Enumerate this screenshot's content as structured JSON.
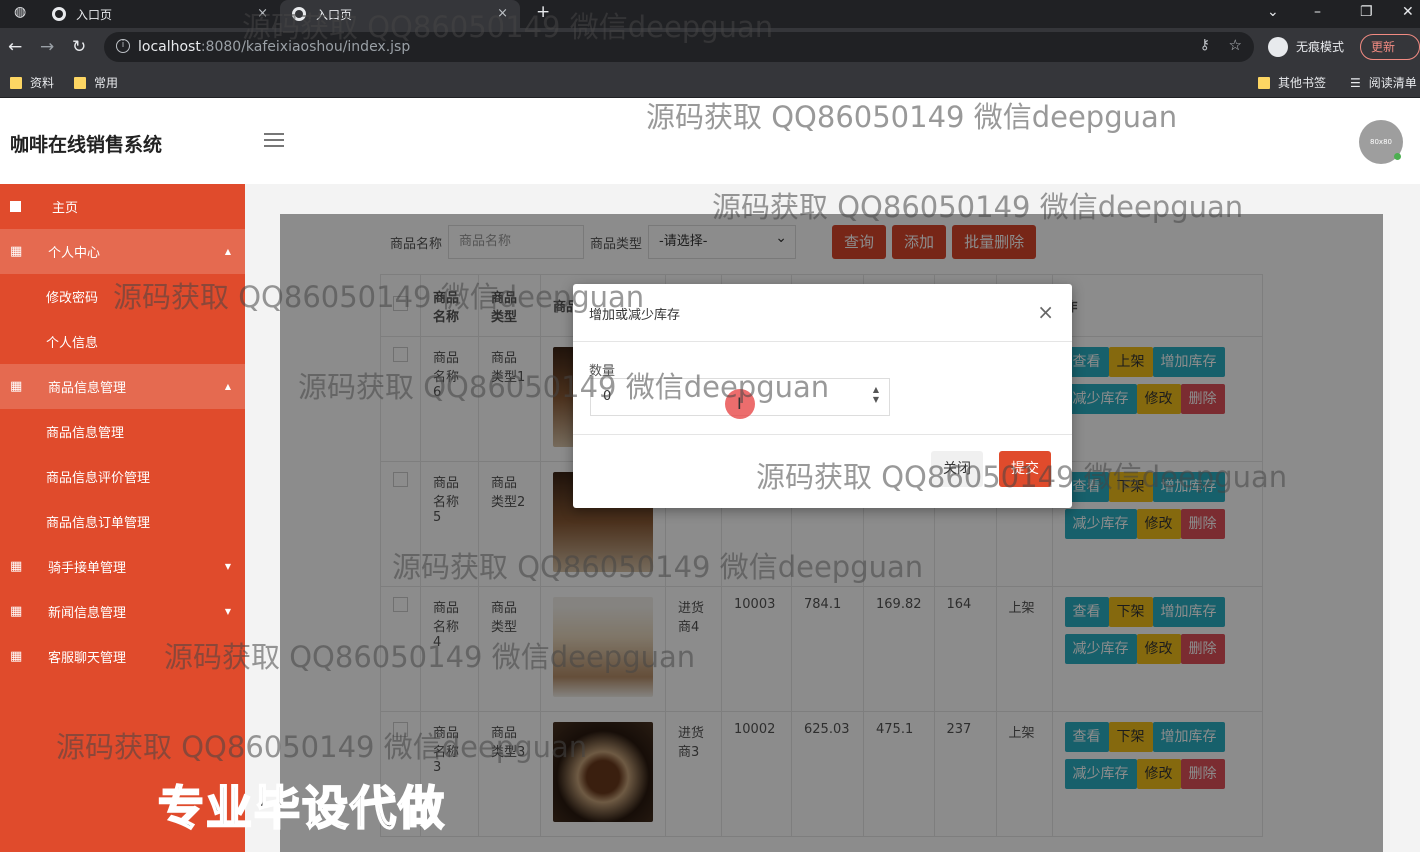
{
  "browser": {
    "tabs": [
      {
        "title": "入口页"
      },
      {
        "title": "入口页"
      }
    ],
    "new_tab": "+",
    "url_host": "localhost",
    "url_rest": ":8080/kafeixiaoshou/index.jsp",
    "incognito_label": "无痕模式",
    "update_label": "更新",
    "bookmarks": [
      "资料",
      "常用"
    ],
    "bookmarks_right": [
      "其他书签",
      "阅读清单"
    ]
  },
  "app": {
    "title": "咖啡在线销售系统",
    "avatar_text": "80x80"
  },
  "sidebar": {
    "items": [
      {
        "label": "主页"
      },
      {
        "label": "个人中心"
      },
      {
        "label": "修改密码"
      },
      {
        "label": "个人信息"
      },
      {
        "label": "商品信息管理"
      },
      {
        "label": "商品信息管理"
      },
      {
        "label": "商品信息评价管理"
      },
      {
        "label": "商品信息订单管理"
      },
      {
        "label": "骑手接单管理"
      },
      {
        "label": "新闻信息管理"
      },
      {
        "label": "客服聊天管理"
      }
    ]
  },
  "search": {
    "name_label": "商品名称",
    "name_placeholder": "商品名称",
    "type_label": "商品类型",
    "type_selected": "-请选择-",
    "query_btn": "查询",
    "add_btn": "添加",
    "batch_delete_btn": "批量删除"
  },
  "table": {
    "headers": [
      "商品名称",
      "商品类型",
      "商品",
      "",
      "",
      "",
      "",
      "",
      "",
      "作"
    ],
    "rows": [
      {
        "name": "商品名称6",
        "type": "商品类型1",
        "supplier": "",
        "code": "",
        "price": "",
        "cost": "",
        "stock": "",
        "status": ""
      },
      {
        "name": "商品名称5",
        "type": "商品类型2",
        "supplier": "",
        "code": "",
        "price": "",
        "cost": "",
        "stock": "",
        "status": ""
      },
      {
        "name": "商品名称4",
        "type": "商品类型",
        "supplier": "进货商4",
        "code": "10003",
        "price": "784.1",
        "cost": "169.82",
        "stock": "164",
        "status": "上架"
      },
      {
        "name": "商品名称3",
        "type": "商品类型3",
        "supplier": "进货商3",
        "code": "10002",
        "price": "625.03",
        "cost": "475.1",
        "stock": "237",
        "status": "上架"
      }
    ],
    "ops": {
      "view": "查看",
      "on_shelf": "上架",
      "off_shelf": "下架",
      "add_stock": "增加库存",
      "reduce_stock": "减少库存",
      "edit": "修改",
      "delete": "删除"
    }
  },
  "modal": {
    "title": "增加或减少库存",
    "close_x": "×",
    "qty_label": "数量",
    "qty_value": "0",
    "close_btn": "关闭",
    "submit_btn": "提交"
  },
  "watermark": {
    "text": "源码获取 QQ86050149 微信deepguan",
    "banner": "专业毕设代做"
  }
}
